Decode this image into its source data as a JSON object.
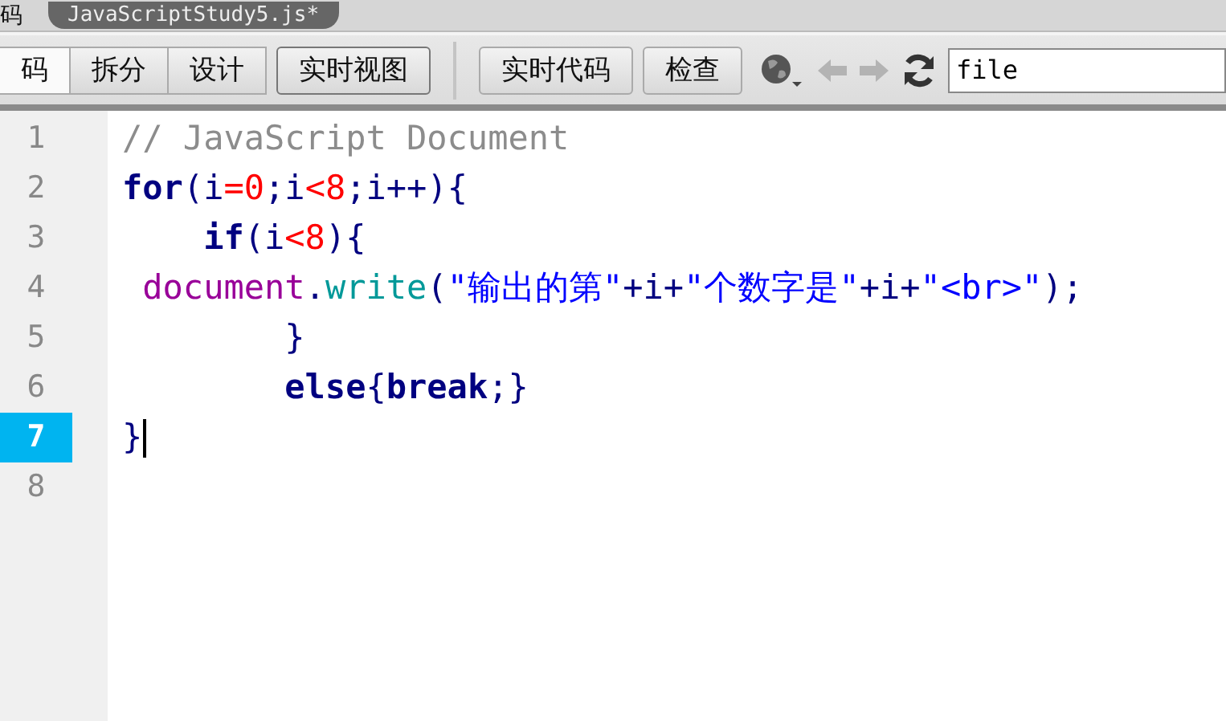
{
  "document_bar": {
    "label": "码",
    "tab": "JavaScriptStudy5.js*"
  },
  "toolbar": {
    "view_buttons": [
      {
        "label": "码",
        "selected": true
      },
      {
        "label": "拆分",
        "selected": false
      },
      {
        "label": "设计",
        "selected": false
      }
    ],
    "live_view": {
      "label": "实时视图",
      "selected": false
    },
    "buttons": [
      "实时代码",
      "检查"
    ],
    "back_disabled": true,
    "forward_disabled": true,
    "address": {
      "value": "file"
    }
  },
  "editor": {
    "lines": [
      {
        "number": "1",
        "current": false,
        "tokens": [
          {
            "kind": "comment",
            "text": "// JavaScript Document"
          }
        ]
      },
      {
        "number": "2",
        "current": false,
        "tokens": [
          {
            "kind": "keyword",
            "text": "for"
          },
          {
            "kind": "plain",
            "text": "(i"
          },
          {
            "kind": "number",
            "text": "=0"
          },
          {
            "kind": "plain",
            "text": ";i"
          },
          {
            "kind": "number",
            "text": "<8"
          },
          {
            "kind": "plain",
            "text": ";i++){"
          }
        ]
      },
      {
        "number": "3",
        "current": false,
        "tokens": [
          {
            "kind": "keyword",
            "text": "    if"
          },
          {
            "kind": "plain",
            "text": "(i"
          },
          {
            "kind": "number",
            "text": "<8"
          },
          {
            "kind": "plain",
            "text": "){"
          }
        ]
      },
      {
        "number": "4",
        "current": false,
        "tokens": [
          {
            "kind": "object",
            "text": " document"
          },
          {
            "kind": "plain",
            "text": "."
          },
          {
            "kind": "function",
            "text": "write"
          },
          {
            "kind": "plain",
            "text": "("
          },
          {
            "kind": "string",
            "text": "\"输出的第\""
          },
          {
            "kind": "plain",
            "text": "+i+"
          },
          {
            "kind": "string",
            "text": "\"个数字是\""
          },
          {
            "kind": "plain",
            "text": "+i+"
          },
          {
            "kind": "string",
            "text": "\"<br>\""
          },
          {
            "kind": "plain",
            "text": ");"
          }
        ]
      },
      {
        "number": "5",
        "current": false,
        "tokens": [
          {
            "kind": "plain",
            "text": "        }"
          }
        ]
      },
      {
        "number": "6",
        "current": false,
        "tokens": [
          {
            "kind": "keyword",
            "text": "        else"
          },
          {
            "kind": "plain",
            "text": "{"
          },
          {
            "kind": "keyword",
            "text": "break"
          },
          {
            "kind": "plain",
            "text": ";}"
          }
        ]
      },
      {
        "number": "7",
        "current": true,
        "tokens": [
          {
            "kind": "plain",
            "text": "}"
          }
        ]
      },
      {
        "number": "8",
        "current": false
      }
    ]
  }
}
